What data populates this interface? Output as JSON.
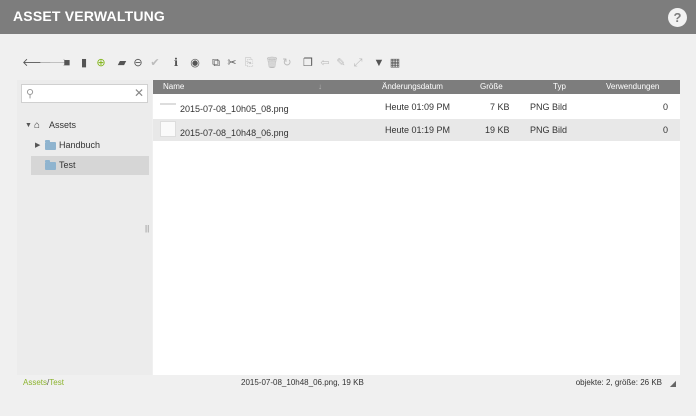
{
  "window": {
    "title": "ASSET VERWALTUNG",
    "help_glyph": "?"
  },
  "toolbar": {
    "icons": [
      {
        "name": "back-icon",
        "glyph": "🡐"
      },
      {
        "name": "forward-icon",
        "glyph": "🡒"
      },
      {
        "name": "new-folder-icon",
        "glyph": "■"
      },
      {
        "name": "new-file-icon",
        "glyph": "▮"
      },
      {
        "name": "add-icon",
        "glyph": "⊕"
      },
      {
        "name": "open-folder-icon",
        "glyph": "▰"
      },
      {
        "name": "download-icon",
        "glyph": "⊖"
      },
      {
        "name": "check-icon",
        "glyph": "✔"
      },
      {
        "name": "info-icon",
        "glyph": "ℹ"
      },
      {
        "name": "preview-icon",
        "glyph": "◉"
      },
      {
        "name": "copy-icon",
        "glyph": "⧉"
      },
      {
        "name": "cut-icon",
        "glyph": "✂"
      },
      {
        "name": "paste-icon",
        "glyph": "⎘"
      },
      {
        "name": "delete-icon",
        "glyph": "🗑"
      },
      {
        "name": "refresh-icon",
        "glyph": "↻"
      },
      {
        "name": "duplicate-icon",
        "glyph": "❐"
      },
      {
        "name": "rename-icon",
        "glyph": "⇦"
      },
      {
        "name": "edit-icon",
        "glyph": "✎"
      },
      {
        "name": "resize-icon",
        "glyph": "⤢"
      },
      {
        "name": "filter-icon",
        "glyph": "▼"
      },
      {
        "name": "grid-icon",
        "glyph": "▦"
      }
    ]
  },
  "sidebar": {
    "search": {
      "value": "",
      "placeholder": ""
    },
    "tree": [
      {
        "label": "Assets",
        "icon": "home-icon",
        "expanded": true
      },
      {
        "label": "Handbuch",
        "icon": "folder-icon",
        "expanded": false
      },
      {
        "label": "Test",
        "icon": "folder-open-icon",
        "selected": true
      }
    ]
  },
  "filelist": {
    "columns": [
      "Name",
      "Änderungsdatum",
      "Größe",
      "Typ",
      "Verwendungen"
    ],
    "rows": [
      {
        "name": "2015-07-08_10h05_08.png",
        "date": "Heute 01:09 PM",
        "size": "7 KB",
        "type": "PNG Bild",
        "uses": "0"
      },
      {
        "name": "2015-07-08_10h48_06.png",
        "date": "Heute 01:19 PM",
        "size": "19 KB",
        "type": "PNG Bild",
        "uses": "0"
      }
    ]
  },
  "status": {
    "crumb_root": "Assets",
    "crumb_sep": "/",
    "crumb_leaf": "Test",
    "selection": "2015-07-08_10h48_06.png, 19 KB",
    "summary": "objekte: 2, größe: 26 KB"
  },
  "colors": {
    "titlebar": "#7d7d7d",
    "accent_green": "#8cb32e",
    "folder": "#8fb4cf"
  }
}
